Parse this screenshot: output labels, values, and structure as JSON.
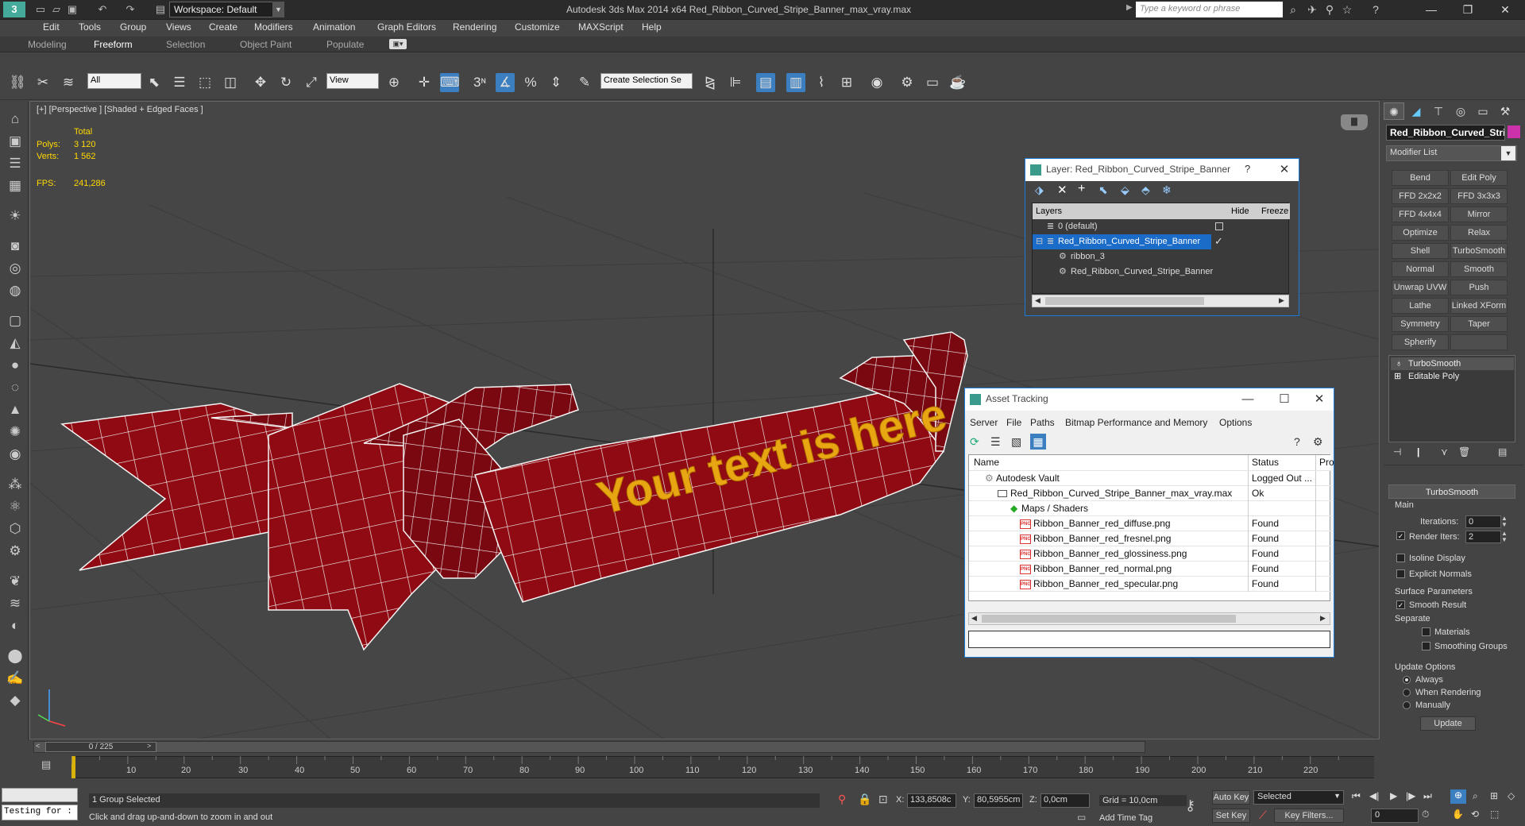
{
  "titlebar": {
    "workspace": "Workspace: Default",
    "title": "Autodesk 3ds Max  2014 x64      Red_Ribbon_Curved_Stripe_Banner_max_vray.max",
    "search_placeholder": "Type a keyword or phrase"
  },
  "menu": [
    "Edit",
    "Tools",
    "Group",
    "Views",
    "Create",
    "Modifiers",
    "Animation",
    "Graph Editors",
    "Rendering",
    "Customize",
    "MAXScript",
    "Help"
  ],
  "ribbon_tabs": [
    "Modeling",
    "Freeform",
    "Selection",
    "Object Paint",
    "Populate"
  ],
  "toolbar": {
    "filter": "All",
    "ref_coord": "View",
    "snap_label": "3",
    "selection_set": "Create Selection Se"
  },
  "viewport": {
    "label": "[+] [Perspective ] [Shaded + Edged Faces ]",
    "stats_header": "Total",
    "polys_label": "Polys:",
    "polys_value": "3 120",
    "verts_label": "Verts:",
    "verts_value": "1 562",
    "fps_label": "FPS:",
    "fps_value": "241,286",
    "banner_text": "Your text is here"
  },
  "layer_dialog": {
    "title": "Layer: Red_Ribbon_Curved_Stripe_Banner",
    "help": "?",
    "headers": {
      "layers": "Layers",
      "hide": "Hide",
      "freeze": "Freeze"
    },
    "rows": [
      {
        "name": "0 (default)"
      },
      {
        "name": "Red_Ribbon_Curved_Stripe_Banner"
      },
      {
        "name": "ribbon_3"
      },
      {
        "name": "Red_Ribbon_Curved_Stripe_Banner"
      }
    ]
  },
  "asset_dialog": {
    "title": "Asset Tracking",
    "menu": [
      "Server",
      "File",
      "Paths",
      "Bitmap Performance and Memory",
      "Options"
    ],
    "headers": {
      "name": "Name",
      "status": "Status",
      "pro": "Pro"
    },
    "rows": [
      {
        "name": "Autodesk Vault",
        "status": "Logged Out ..."
      },
      {
        "name": "Red_Ribbon_Curved_Stripe_Banner_max_vray.max",
        "status": "Ok"
      },
      {
        "name": "Maps / Shaders",
        "status": ""
      },
      {
        "name": "Ribbon_Banner_red_diffuse.png",
        "status": "Found"
      },
      {
        "name": "Ribbon_Banner_red_fresnel.png",
        "status": "Found"
      },
      {
        "name": "Ribbon_Banner_red_glossiness.png",
        "status": "Found"
      },
      {
        "name": "Ribbon_Banner_red_normal.png",
        "status": "Found"
      },
      {
        "name": "Ribbon_Banner_red_specular.png",
        "status": "Found"
      }
    ],
    "png_label": "PNG"
  },
  "command_panel": {
    "object_name": "Red_Ribbon_Curved_Stri",
    "modifier_list": "Modifier List",
    "modifier_buttons": [
      "Bend",
      "Edit Poly",
      "FFD 2x2x2",
      "FFD 3x3x3",
      "FFD 4x4x4",
      "Mirror",
      "Optimize",
      "Relax",
      "Shell",
      "TurboSmooth",
      "Normal",
      "Smooth",
      "Unwrap UVW",
      "Push",
      "Lathe",
      "Linked XForm",
      "Symmetry",
      "Taper",
      "Spherify",
      ""
    ],
    "stack": [
      "TurboSmooth",
      "Editable Poly"
    ],
    "rollout": "TurboSmooth",
    "main": "Main",
    "iterations_label": "Iterations:",
    "iterations": "0",
    "render_iters_label": "Render Iters:",
    "render_iters": "2",
    "isoline": "Isoline Display",
    "explicit": "Explicit Normals",
    "surface": "Surface Parameters",
    "smooth_result": "Smooth Result",
    "separate": "Separate",
    "materials": "Materials",
    "smoothing_groups": "Smoothing Groups",
    "update_options": "Update Options",
    "always": "Always",
    "when_rendering": "When Rendering",
    "manually": "Manually",
    "update": "Update"
  },
  "timeline": {
    "frame": "0 / 225",
    "ticks": [
      "10",
      "20",
      "30",
      "40",
      "50",
      "60",
      "70",
      "80",
      "90",
      "100",
      "110",
      "120",
      "130",
      "140",
      "150",
      "160",
      "170",
      "180",
      "190",
      "200",
      "210",
      "220"
    ]
  },
  "status": {
    "maxscript": "Testing for :",
    "selected": "1 Group Selected",
    "prompt": "Click and drag up-and-down to zoom in and out",
    "x_label": "X:",
    "x": "133,8508c",
    "y_label": "Y:",
    "y": "80,5955cm",
    "z_label": "Z:",
    "z": "0,0cm",
    "grid": "Grid = 10,0cm",
    "add_time_tag": "Add Time Tag",
    "auto_key": "Auto Key",
    "set_key": "Set Key",
    "key_mode": "Selected",
    "key_filters": "Key Filters...",
    "frame_field": "0"
  }
}
